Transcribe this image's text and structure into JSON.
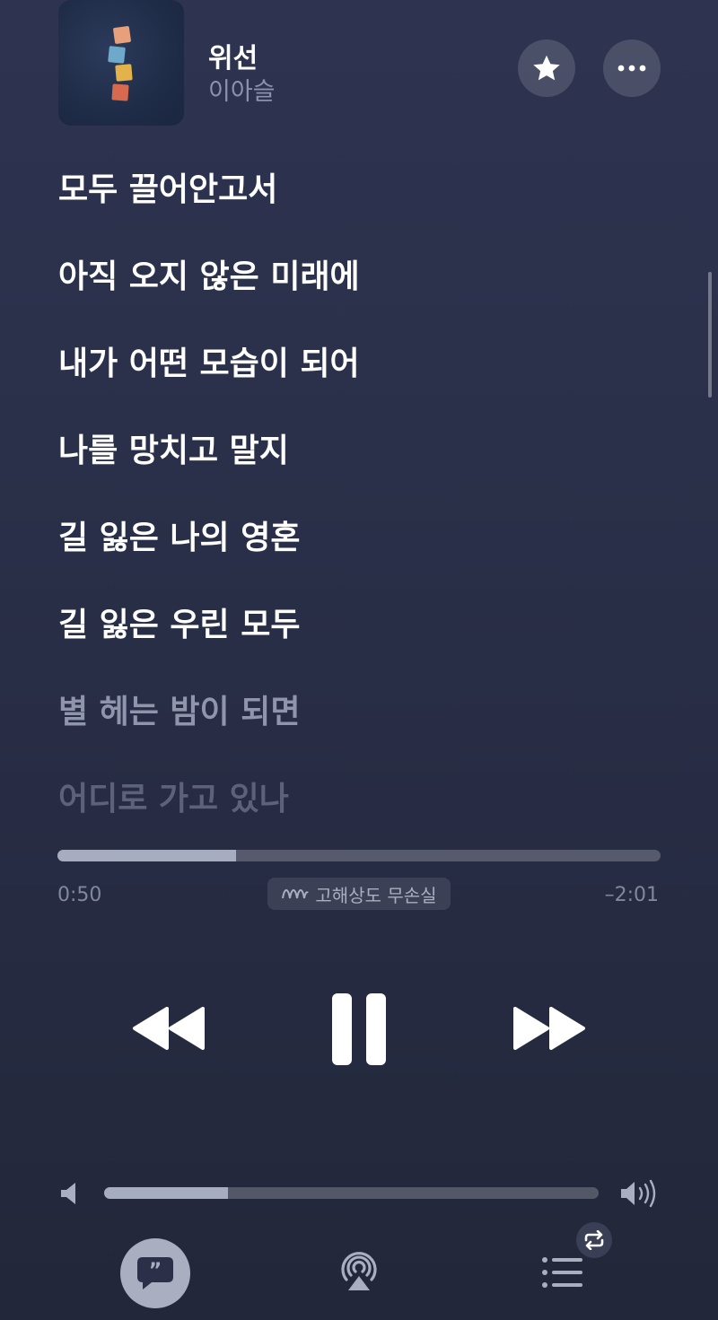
{
  "now_playing": {
    "title": "위선",
    "artist": "이아슬"
  },
  "header_buttons": {
    "favorite_icon": "star-icon",
    "more_icon": "ellipsis-icon"
  },
  "lyrics": [
    {
      "text": "모두 끌어안고서",
      "state": "past"
    },
    {
      "text": "아직 오지 않은 미래에",
      "state": "past"
    },
    {
      "text": "내가 어떤 모습이 되어",
      "state": "past"
    },
    {
      "text": "나를 망치고 말지",
      "state": "past"
    },
    {
      "text": "길 잃은 나의 영혼",
      "state": "current"
    },
    {
      "text": "길 잃은 우린 모두",
      "state": "current"
    },
    {
      "text": "별 헤는 밤이 되면",
      "state": "upcoming"
    },
    {
      "text": "어디로 가고 있나",
      "state": "upcoming"
    }
  ],
  "playback": {
    "elapsed": "0:50",
    "remaining": "–2:01",
    "progress_fraction": 0.296,
    "quality_label": "고해상도 무손실",
    "quality_icon": "hi-res-lossless-icon"
  },
  "transport": {
    "rewind_icon": "rewind-icon",
    "pause_icon": "pause-icon",
    "forward_icon": "fast-forward-icon"
  },
  "volume": {
    "level_fraction": 0.25
  },
  "bottom_bar": {
    "lyrics_icon": "lyrics-quote-icon",
    "airplay_icon": "airplay-icon",
    "queue_icon": "queue-list-icon",
    "repeat_icon": "repeat-icon"
  },
  "colors": {
    "background_top": "#2e3450",
    "background_bottom": "#222739",
    "lyric_active": "#ffffff",
    "lyric_upcoming_1": "#8f95ab",
    "lyric_upcoming_2": "#5c6279",
    "secondary_text": "#8b92ab"
  }
}
